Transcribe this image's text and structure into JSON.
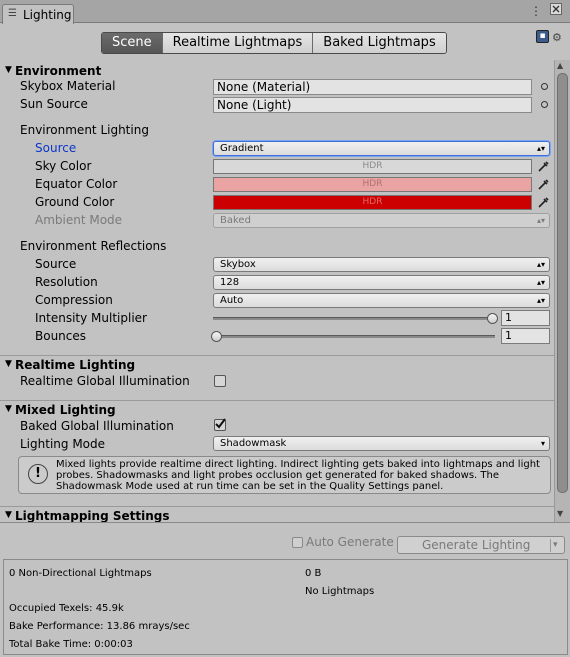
{
  "window": {
    "tab_title": "Lighting"
  },
  "mode_tabs": [
    "Scene",
    "Realtime Lightmaps",
    "Baked Lightmaps"
  ],
  "environment": {
    "title": "Environment",
    "skybox_label": "Skybox Material",
    "skybox_value": "None (Material)",
    "sun_label": "Sun Source",
    "sun_value": "None (Light)",
    "env_lighting_label": "Environment Lighting",
    "source_label": "Source",
    "source_value": "Gradient",
    "sky_color_label": "Sky Color",
    "equator_color_label": "Equator Color",
    "ground_color_label": "Ground Color",
    "hdr": "HDR",
    "ambient_mode_label": "Ambient Mode",
    "ambient_mode_value": "Baked",
    "colors": {
      "sky": "#d8d8d8",
      "equator": "#e9a3a3",
      "ground": "#cc0000"
    }
  },
  "reflections": {
    "title": "Environment Reflections",
    "source_label": "Source",
    "source_value": "Skybox",
    "resolution_label": "Resolution",
    "resolution_value": "128",
    "compression_label": "Compression",
    "compression_value": "Auto",
    "intensity_label": "Intensity Multiplier",
    "intensity_value": "1",
    "bounces_label": "Bounces",
    "bounces_value": "1"
  },
  "realtime": {
    "title": "Realtime Lighting",
    "gi_label": "Realtime Global Illumination",
    "gi_checked": false
  },
  "mixed": {
    "title": "Mixed Lighting",
    "baked_gi_label": "Baked Global Illumination",
    "baked_gi_checked": true,
    "mode_label": "Lighting Mode",
    "mode_value": "Shadowmask",
    "help_text": "Mixed lights provide realtime direct lighting. Indirect lighting gets baked into lightmaps and light probes. Shadowmasks and light probes occlusion get generated for baked shadows. The Shadowmask Mode used at run time can be set in the Quality Settings panel."
  },
  "lightmapping": {
    "title": "Lightmapping Settings"
  },
  "bottom": {
    "auto_generate_label": "Auto Generate",
    "auto_generate_checked": false,
    "generate_button": "Generate Lighting"
  },
  "stats": {
    "lightmaps": "0 Non-Directional Lightmaps",
    "size": "0 B",
    "no_lightmaps": "No Lightmaps",
    "texels": "Occupied Texels: 45.9k",
    "performance": "Bake Performance: 13.86 mrays/sec",
    "bake_time": "Total Bake Time: 0:00:03"
  }
}
